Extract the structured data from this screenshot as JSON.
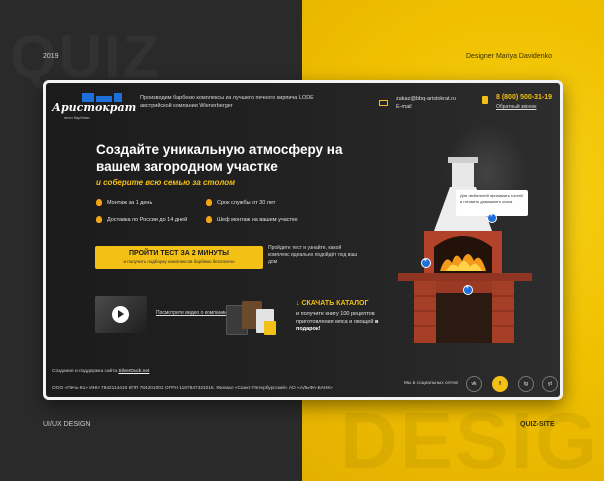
{
  "meta": {
    "year": "2019",
    "designer": "Designer Mariya Davidenko",
    "category": "UI/UX DESIGN",
    "project": "QUIZ-SITE",
    "bg_word_top": "QUIZ",
    "bg_word_bottom": "DESIGN"
  },
  "header": {
    "logo_text": "Аристократ",
    "logo_sub": "печи барбекю",
    "tagline": "Производим барбекю комплексы из лучшего печного кирпича LODE австрийской компании Wienerberger",
    "email": "zakaz@bbq-aristokrat.ru",
    "email_label": "E-mail",
    "phone": "8 (800) 500-31-19",
    "callback": "Обратный звонок"
  },
  "hero": {
    "title": "Создайте уникальную атмосферу на вашем загородном участке",
    "subtitle": "и соберите всю семью за столом",
    "features": [
      "Монтаж за 1 день",
      "Срок службы от 30 лет",
      "Доставка по России до 14 дней",
      "Шеф монтаж на вашем участке"
    ]
  },
  "cta": {
    "title": "ПРОЙТИ ТЕСТ ЗА 2 МИНУТЫ",
    "sub": "и получить подборку комплексов барбекю бесплатно",
    "note": "Пройдите тест и узнайте, какой комплекс идеально подойдёт под ваш дом"
  },
  "video": {
    "label": "Посмотрите видео о компании"
  },
  "catalog": {
    "title": "СКАЧАТЬ КАТАЛОГ",
    "text": "и получите книгу 100 рецептов приготовления мяса и овощей",
    "gift": "в подарок!"
  },
  "product": {
    "tooltip": "Для любителей принимать гостей и готовить домашнего очага"
  },
  "footer": {
    "made_by_prefix": "Создание и поддержка сайта",
    "made_by_link": "SilverDuck.net",
    "legal": "ООО «Печь-Ко» ИНН 7842114410 КПП 784201001 ОГРН 1167847323216. Филиал «Санкт-Петербургский» АО «АЛЬФА-БАНК»",
    "social_label": "Мы в социальных сетях!",
    "social": [
      "vk",
      "f",
      "ig",
      "yt"
    ]
  },
  "colors": {
    "accent": "#f3c016",
    "brand_blue": "#1e6fd9",
    "dark_bg": "#1b1b1b"
  }
}
